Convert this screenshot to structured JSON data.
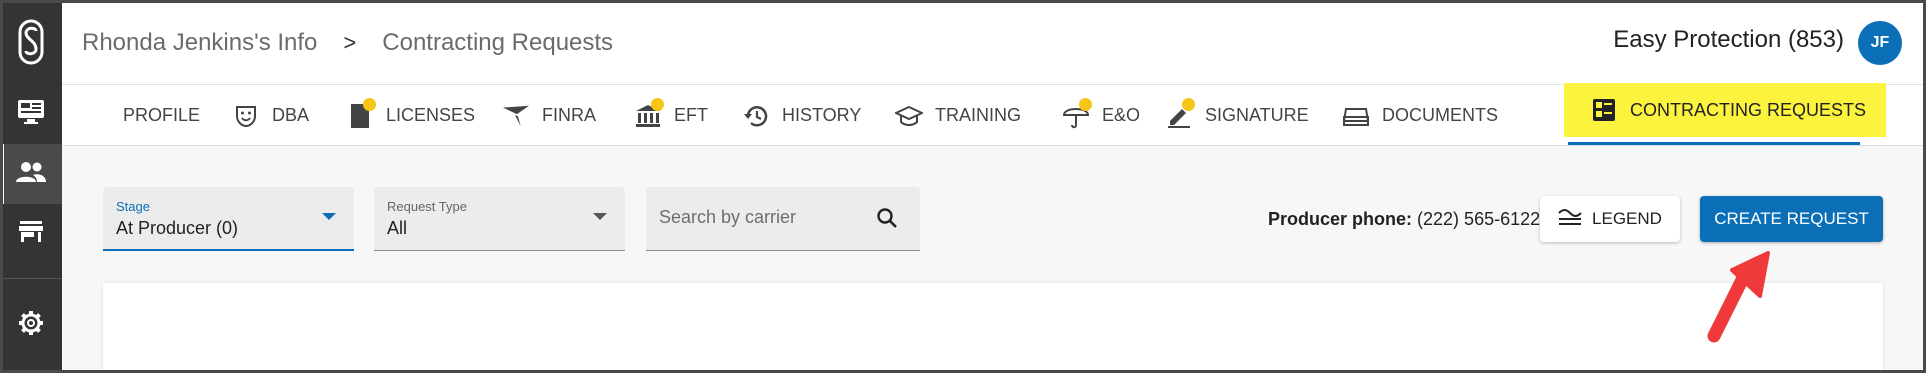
{
  "header": {
    "breadcrumb": [
      "Rhonda Jenkins's Info",
      "Contracting Requests"
    ],
    "breadcrumb_separator": ">",
    "agency": "Easy Protection (853)",
    "avatar_initials": "JF"
  },
  "rail": {
    "items": [
      {
        "icon": "monitor-icon"
      },
      {
        "icon": "people-icon",
        "active": true
      },
      {
        "icon": "store-icon"
      },
      {
        "icon": "gear-icon"
      }
    ]
  },
  "tabs": [
    {
      "label": "PROFILE"
    },
    {
      "label": "DBA",
      "icon": "mask-icon"
    },
    {
      "label": "LICENSES",
      "icon": "license-icon",
      "dot": true
    },
    {
      "label": "FINRA",
      "icon": "finra-icon"
    },
    {
      "label": "EFT",
      "icon": "bank-icon",
      "dot": true
    },
    {
      "label": "HISTORY",
      "icon": "history-icon"
    },
    {
      "label": "TRAINING",
      "icon": "graduation-cap-icon"
    },
    {
      "label": "E&O",
      "icon": "umbrella-icon",
      "dot": true
    },
    {
      "label": "SIGNATURE",
      "icon": "pen-icon",
      "dot": true
    },
    {
      "label": "DOCUMENTS",
      "icon": "documents-icon"
    },
    {
      "label": "CONTRACTING REQUESTS",
      "icon": "list-icon",
      "active": true
    }
  ],
  "filters": {
    "stage": {
      "label": "Stage",
      "value": "At Producer (0)"
    },
    "request_type": {
      "label": "Request Type",
      "value": "All"
    },
    "search": {
      "placeholder": "Search by carrier"
    }
  },
  "producer_phone": {
    "label": "Producer phone:",
    "value": "(222) 565-6122"
  },
  "buttons": {
    "legend": "LEGEND",
    "create_request": "CREATE REQUEST"
  },
  "colors": {
    "accent": "#0b6fb8",
    "highlight": "#fbf33d",
    "rail": "#343434",
    "dot": "#f5c518",
    "arrow": "#ee3a3a"
  }
}
